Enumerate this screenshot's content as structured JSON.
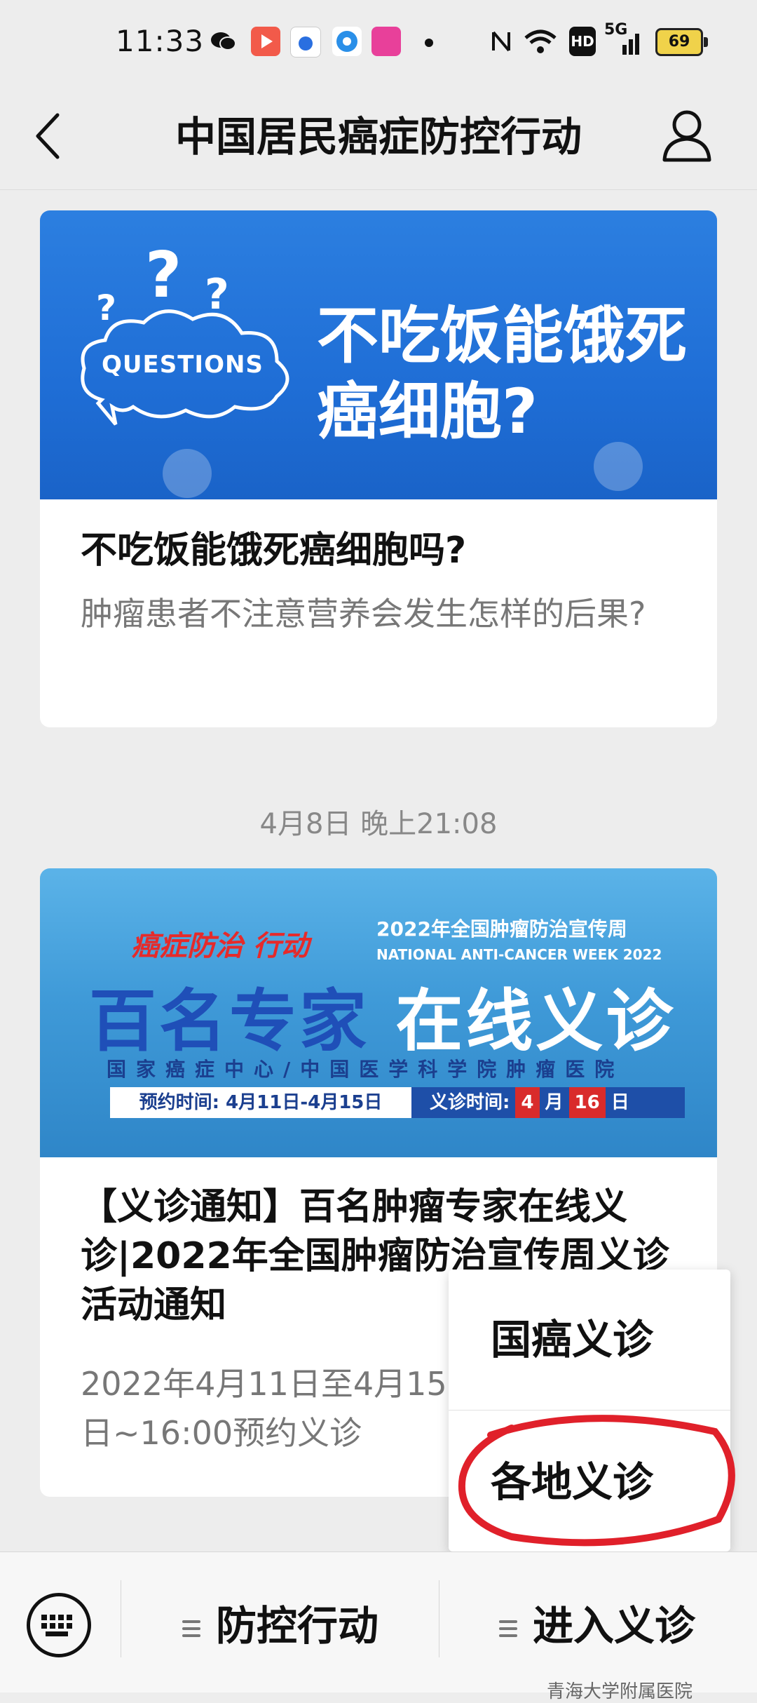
{
  "status_bar": {
    "time": "11:33",
    "network": "5G",
    "battery": "69",
    "icons": [
      "wechat-icon",
      "video-app-icon",
      "baidu-icon",
      "browser-icon",
      "shopping-app-icon",
      "dot-icon",
      "nfc-icon",
      "wifi-icon",
      "hd-icon",
      "signal-icon",
      "battery-icon"
    ]
  },
  "header": {
    "title": "中国居民癌症防控行动",
    "back_icon": "chevron-left-icon",
    "profile_icon": "user-icon"
  },
  "article1": {
    "banner_cloud_label": "QUESTIONS",
    "banner_heading_line1": "不吃饭能饿死",
    "banner_heading_line2": "癌细胞?",
    "title": "不吃饭能饿死癌细胞吗?",
    "subtitle": "肿瘤患者不注意营养会发生怎样的后果?"
  },
  "timestamp": "4月8日 晚上21:08",
  "article2": {
    "banner_logo": "癌症防治 行动",
    "banner_week_cn": "2022年全国肿瘤防治宣传周",
    "banner_week_en": "NATIONAL ANTI-CANCER WEEK 2022",
    "banner_main_left": "百名专家",
    "banner_main_right": "在线义诊",
    "banner_org": "国家癌症中心/中国医学科学院肿瘤医院",
    "banner_booking": "预约时间: 4月11日-4月15日",
    "banner_clinic_label": "义诊时间:",
    "banner_clinic_month": "4",
    "banner_clinic_month_unit": "月",
    "banner_clinic_day": "16",
    "banner_clinic_day_unit": "日",
    "title": "【义诊通知】百名肿瘤专家在线义诊|2022年全国肿瘤防治宣传周义诊活动通知",
    "subtitle": "2022年4月11日至4月15日~16:00预约义诊"
  },
  "popup_menu": {
    "items": [
      "国癌义诊",
      "各地义诊"
    ]
  },
  "bottom_bar": {
    "keyboard_icon": "keyboard-icon",
    "menu1": "防控行动",
    "menu2": "进入义诊"
  },
  "watermark": "青海大学附属医院",
  "colors": {
    "banner1": "#1f6ed6",
    "banner2": "#3f9ad8",
    "highlight_circle": "#e0202a"
  }
}
